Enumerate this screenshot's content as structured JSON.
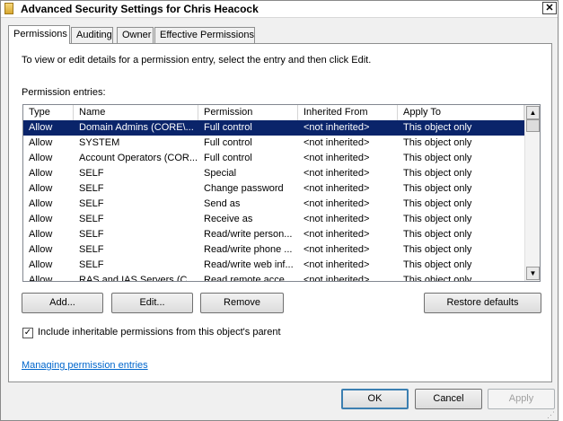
{
  "window": {
    "title": "Advanced Security Settings for Chris Heacock"
  },
  "tabs": [
    {
      "label": "Permissions"
    },
    {
      "label": "Auditing"
    },
    {
      "label": "Owner"
    },
    {
      "label": "Effective Permissions"
    }
  ],
  "permissions": {
    "info": "To view or edit details for a permission entry, select the entry and then click Edit.",
    "entries_label": "Permission entries:",
    "columns": [
      "Type",
      "Name",
      "Permission",
      "Inherited From",
      "Apply To"
    ],
    "rows": [
      [
        "Allow",
        "Domain Admins (CORE\\...",
        "Full control",
        "<not inherited>",
        "This object only"
      ],
      [
        "Allow",
        "SYSTEM",
        "Full control",
        "<not inherited>",
        "This object only"
      ],
      [
        "Allow",
        "Account Operators (COR...",
        "Full control",
        "<not inherited>",
        "This object only"
      ],
      [
        "Allow",
        "SELF",
        "Special",
        "<not inherited>",
        "This object only"
      ],
      [
        "Allow",
        "SELF",
        "Change password",
        "<not inherited>",
        "This object only"
      ],
      [
        "Allow",
        "SELF",
        "Send as",
        "<not inherited>",
        "This object only"
      ],
      [
        "Allow",
        "SELF",
        "Receive as",
        "<not inherited>",
        "This object only"
      ],
      [
        "Allow",
        "SELF",
        "Read/write person...",
        "<not inherited>",
        "This object only"
      ],
      [
        "Allow",
        "SELF",
        "Read/write phone ...",
        "<not inherited>",
        "This object only"
      ],
      [
        "Allow",
        "SELF",
        "Read/write web inf...",
        "<not inherited>",
        "This object only"
      ],
      [
        "Allow",
        "RAS and IAS Servers (C...",
        "Read remote acce...",
        "<not inherited>",
        "This object only"
      ]
    ],
    "buttons": {
      "add": "Add...",
      "edit": "Edit...",
      "remove": "Remove",
      "restore": "Restore defaults"
    },
    "include_inheritable": {
      "label": "Include inheritable permissions from this object's parent",
      "checked": true
    },
    "link": "Managing permission entries"
  },
  "footer": {
    "ok": "OK",
    "cancel": "Cancel",
    "apply": "Apply"
  },
  "icons": {
    "checkbox": "check-icon",
    "close": "close-icon",
    "scroll_up": "arrow-up-icon",
    "scroll_down": "arrow-down-icon"
  },
  "colors": {
    "selection": "#0a246a",
    "link": "#0066cc"
  }
}
